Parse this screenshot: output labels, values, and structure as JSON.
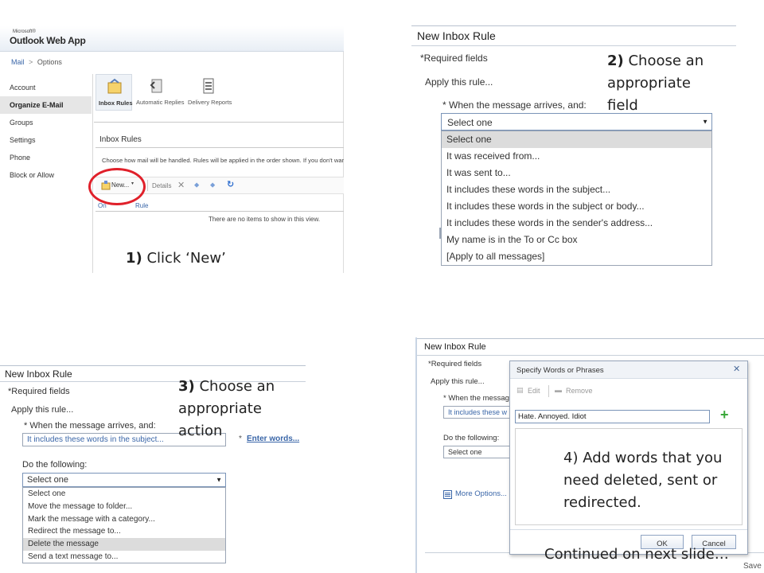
{
  "panel1": {
    "brand_small": "Microsoft®",
    "brand": "Outlook Web App",
    "breadcrumb_mail": "Mail",
    "breadcrumb_sep": ">",
    "breadcrumb_options": "Options",
    "nav": [
      "Account",
      "Organize E-Mail",
      "Groups",
      "Settings",
      "Phone",
      "Block or Allow"
    ],
    "tabs": [
      "Inbox Rules",
      "Automatic Replies",
      "Delivery Reports"
    ],
    "section_title": "Inbox Rules",
    "description": "Choose how mail will be handled. Rules will be applied in the order shown. If you don't want",
    "toolbar_new": "New...",
    "toolbar_details": "Details",
    "col_on": "On",
    "col_rule": "Rule",
    "empty_text": "There are no items to show in this view.",
    "callout_num": "1)",
    "callout_text": " Click ‘New’",
    "circle_color": "#e0202a"
  },
  "panel2": {
    "title": "New Inbox Rule",
    "required": "*Required fields",
    "apply": "Apply this rule...",
    "when": "* When the message arrives, and:",
    "selected": "Select one",
    "options": [
      "Select one",
      "It was received from...",
      "It was sent to...",
      "It includes these words in the subject...",
      "It includes these words in the subject or body...",
      "It includes these words in the sender's address...",
      "My name is in the To or Cc box",
      "[Apply to all messages]"
    ],
    "callout_num": "2)",
    "callout_lines": [
      " Choose an",
      "appropriate",
      "field"
    ]
  },
  "panel3": {
    "title": "New Inbox Rule",
    "required": "*Required fields",
    "apply": "Apply this rule...",
    "when": "* When the message arrives, and:",
    "condition_value": "It includes these words in the subject...",
    "enter_words": "Enter words...",
    "do_following": "Do the following:",
    "selected": "Select one",
    "options": [
      "Select one",
      "Move the message to folder...",
      "Mark the message with a category...",
      "Redirect the message to...",
      "Delete the message",
      "Send a text message to..."
    ],
    "highlighted_index": 4,
    "callout_num": "3)",
    "callout_lines": [
      " Choose an",
      "appropriate",
      "action"
    ]
  },
  "panel4": {
    "title": "New Inbox Rule",
    "required": "*Required fields",
    "apply": "Apply this rule...",
    "when": "* When the messag",
    "condition_value": "It includes these w",
    "do_following": "Do the following:",
    "action_value": "Select one",
    "more_options": "More Options...",
    "dialog_title": "Specify Words or Phrases",
    "edit": "Edit",
    "remove": "Remove",
    "words_value": "Hate. Annoyed. Idiot",
    "ok": "OK",
    "cancel": "Cancel",
    "save_frag": "Save",
    "callout_num": "4",
    "callout_lines": [
      ") Add words that you",
      "need deleted, sent or",
      "redirected."
    ],
    "continued": "Continued on next slide…"
  }
}
